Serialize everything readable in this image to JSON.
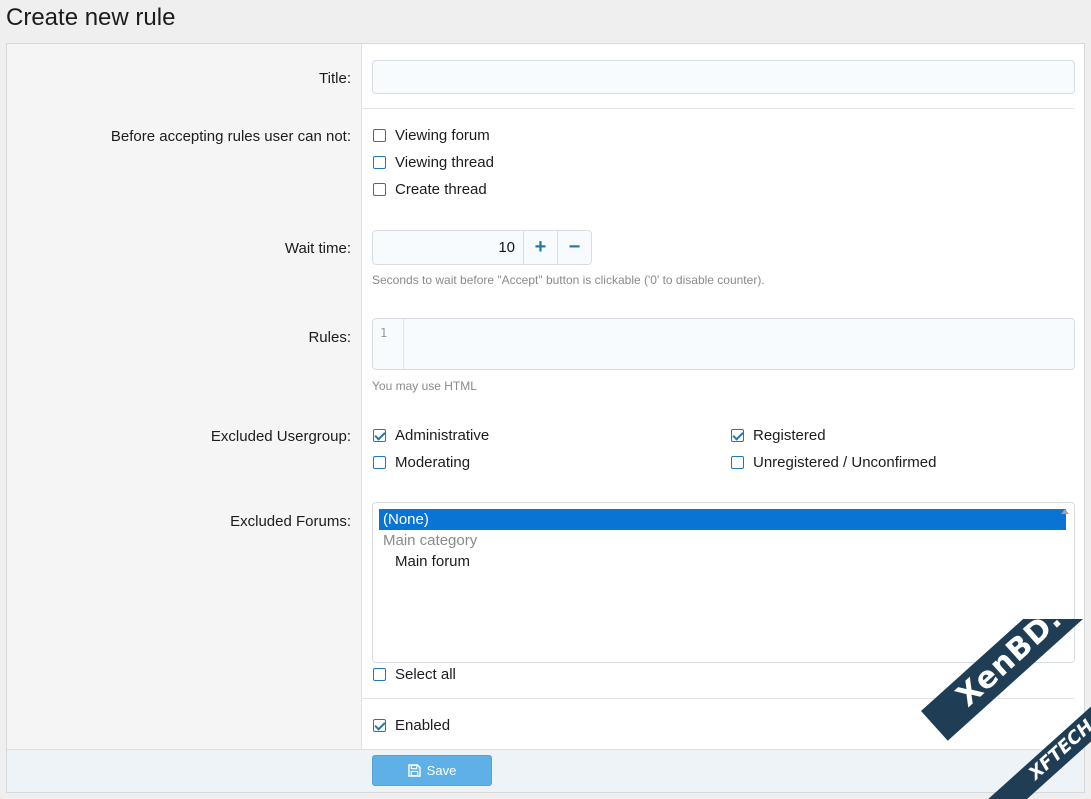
{
  "page": {
    "title": "Create new rule"
  },
  "form": {
    "title": {
      "label": "Title:",
      "value": "",
      "placeholder": ""
    },
    "restrictions": {
      "label": "Before accepting rules user can not:",
      "options": [
        {
          "label": "Viewing forum",
          "checked": false
        },
        {
          "label": "Viewing thread",
          "checked": false
        },
        {
          "label": "Create thread",
          "checked": false
        }
      ]
    },
    "wait_time": {
      "label": "Wait time:",
      "value": "10",
      "increment_icon": "+",
      "decrement_icon": "−",
      "hint": "Seconds to wait before \"Accept\" button is clickable ('0' to disable counter)."
    },
    "rules": {
      "label": "Rules:",
      "line_number": "1",
      "value": "",
      "hint": "You may use HTML"
    },
    "excluded_usergroup": {
      "label": "Excluded Usergroup:",
      "options": [
        {
          "label": "Administrative",
          "checked": true
        },
        {
          "label": "Registered",
          "checked": true
        },
        {
          "label": "Moderating",
          "checked": false
        },
        {
          "label": "Unregistered / Unconfirmed",
          "checked": false
        }
      ]
    },
    "excluded_forums": {
      "label": "Excluded Forums:",
      "options": [
        {
          "label": "(None)",
          "selected": true,
          "kind": "option"
        },
        {
          "label": "Main category",
          "selected": false,
          "kind": "category"
        },
        {
          "label": "Main forum",
          "selected": false,
          "kind": "child"
        }
      ],
      "select_all": {
        "label": "Select all",
        "checked": false
      }
    },
    "enabled": {
      "label": "Enabled",
      "checked": true
    }
  },
  "footer": {
    "save_label": "Save",
    "save_icon": "save-icon"
  },
  "watermark": {
    "line1": "XenBD.Com",
    "line2": "XFTECH"
  },
  "colors": {
    "accent": "#2577b1",
    "selected": "#0a74d4",
    "save_button": "#5fb0e6"
  }
}
